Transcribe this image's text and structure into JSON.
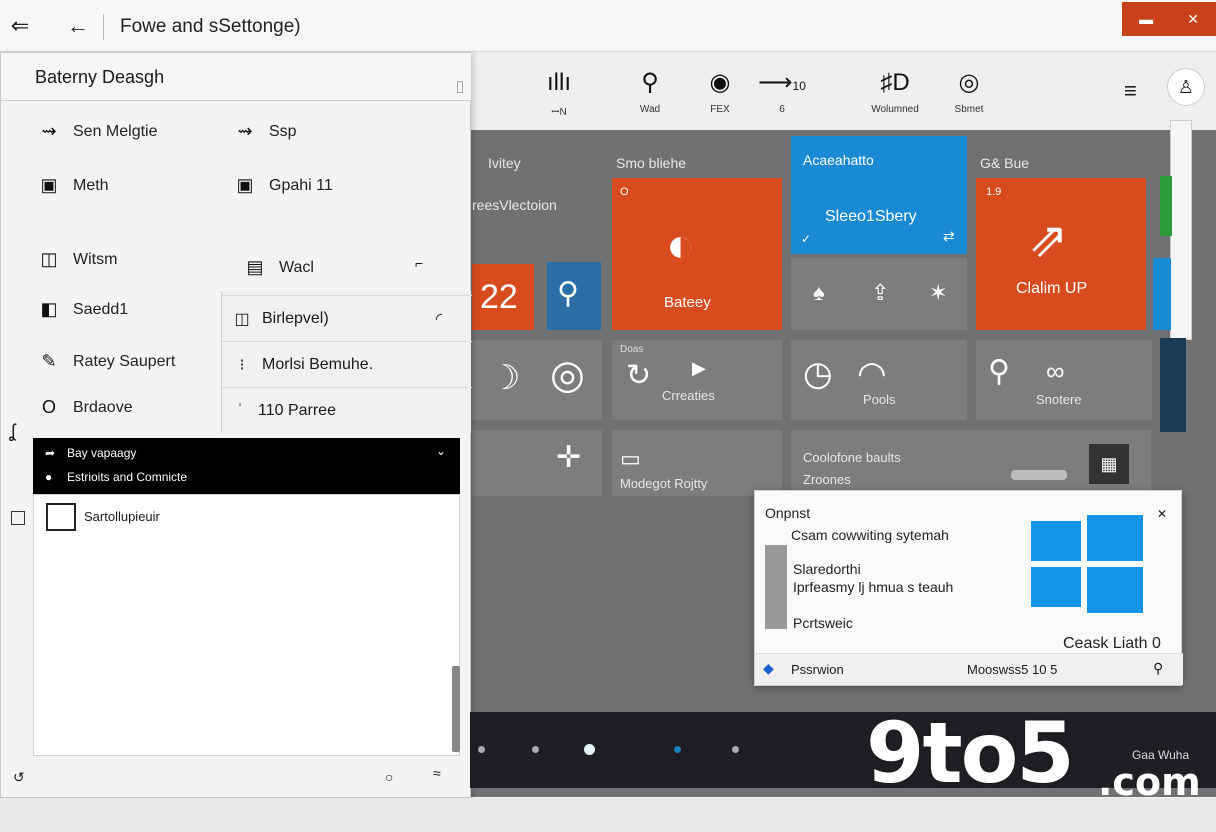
{
  "titlebar": {
    "title": "Fowe and sSettonge)",
    "back_glyph": "⇐",
    "back2_glyph": "←"
  },
  "ribbon": {
    "items": [
      {
        "icon": "ıllı",
        "label": "ꟷN"
      },
      {
        "icon": "⚲",
        "label": "Wad"
      },
      {
        "icon": "◉",
        "label": "FEX"
      },
      {
        "icon": "⟶",
        "label": "6"
      },
      {
        "icon": "♯D",
        "label": "Wolumned"
      },
      {
        "icon": "◎",
        "label": "Sbmet"
      }
    ],
    "line_value": "10"
  },
  "panel": {
    "title": "Baterny   Deasgh",
    "options": [
      {
        "label": "Sen Melgtie",
        "icon": "⇝"
      },
      {
        "label": "Ssp",
        "icon": "⇝"
      },
      {
        "label": "Meth",
        "icon": "▣"
      },
      {
        "label": "Gpahi 11",
        "icon": "▣"
      },
      {
        "label": "Witsm",
        "icon": "◫"
      },
      {
        "label": "Wacl",
        "icon": "▤"
      },
      {
        "label": "Saedd1",
        "icon": "◧"
      },
      {
        "label": "Ratey Saupert",
        "icon": "✎"
      },
      {
        "label": "Brdaove",
        "icon": "O"
      }
    ],
    "sub_rows": [
      "Birlepvel)",
      "Morlsi Bemuhe.",
      "110 Parree"
    ],
    "dark_list": [
      "Bay vapaagy",
      "Estrioits and Comnicte"
    ],
    "content_item": "Sartollupieuir"
  },
  "tiles": {
    "header_1": "Ivitey",
    "header_2": "Smo bliehe",
    "header_3": "Acaeahatto",
    "header_4": "G& Bue",
    "subheader": "reesVlectoion",
    "number_tile": "22",
    "battery_label": "Bateey",
    "sleep_label": "Sleeo1Sbery",
    "claim_label": "Clalim UP",
    "tile_o": "O",
    "tile_19": "1.9",
    "creates_label": "Crreaties",
    "pools_label": "Pools",
    "shore_label": "Snotere",
    "doas_label": "Doas",
    "device_label": "Modegot Rojtty",
    "coolo_label": "Coolofone baults",
    "zrones_label": "Zroones"
  },
  "card": {
    "title": "Onpnst",
    "line1": "Csam cowwiting sytemah",
    "line2": "Slaredorthi",
    "line3": "Iprfeasmy lj hmua s teauh",
    "line4": "Pcrtsweic",
    "right_text": "Ceask Liath 0",
    "footer_left": "Pssrwion",
    "footer_right": "Mooswss5 10 5",
    "windows_color": "#1496e6"
  },
  "corner_text": "Gaa Wuha",
  "watermark": {
    "main": "9to5",
    "suffix": ".com"
  },
  "colors": {
    "orange": "#d84b1f",
    "blue": "#1a8ad4",
    "gray": "#6f7173"
  }
}
